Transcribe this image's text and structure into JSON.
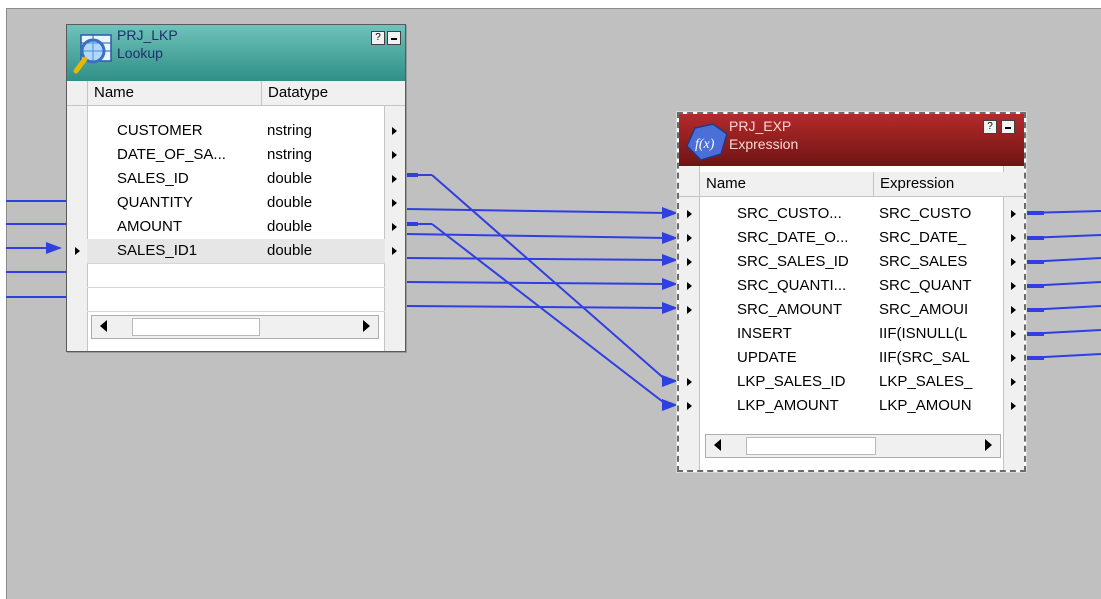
{
  "lookup": {
    "name": "PRJ_LKP",
    "type": "Lookup",
    "help_btn": "?",
    "columns": [
      "Name",
      "Datatype"
    ],
    "ports": [
      {
        "name": "CUSTOMER",
        "datatype": "nstring"
      },
      {
        "name": "DATE_OF_SA...",
        "datatype": "nstring"
      },
      {
        "name": "SALES_ID",
        "datatype": "double"
      },
      {
        "name": "QUANTITY",
        "datatype": "double"
      },
      {
        "name": "AMOUNT",
        "datatype": "double"
      },
      {
        "name": "SALES_ID1",
        "datatype": "double"
      }
    ],
    "icon": "lookup-icon"
  },
  "expression": {
    "name": "PRJ_EXP",
    "type": "Expression",
    "help_btn": "?",
    "columns": [
      "Name",
      "Expression"
    ],
    "ports": [
      {
        "name": "SRC_CUSTO...",
        "expression": "SRC_CUSTO"
      },
      {
        "name": "SRC_DATE_O...",
        "expression": "SRC_DATE_"
      },
      {
        "name": "SRC_SALES_ID",
        "expression": "SRC_SALES"
      },
      {
        "name": "SRC_QUANTI...",
        "expression": "SRC_QUANT"
      },
      {
        "name": "SRC_AMOUNT",
        "expression": "SRC_AMOUI"
      },
      {
        "name": "INSERT",
        "expression": "IIF(ISNULL(L"
      },
      {
        "name": "UPDATE",
        "expression": "IIF(SRC_SAL"
      },
      {
        "name": "LKP_SALES_ID",
        "expression": "LKP_SALES_"
      },
      {
        "name": "LKP_AMOUNT",
        "expression": "LKP_AMOUN"
      }
    ],
    "icon": "expression-icon"
  },
  "colors": {
    "canvas": "#c0c0c0",
    "link": "#2f3fe0",
    "lookup_header": "#2f8f86",
    "expression_header": "#8a1b1b"
  }
}
